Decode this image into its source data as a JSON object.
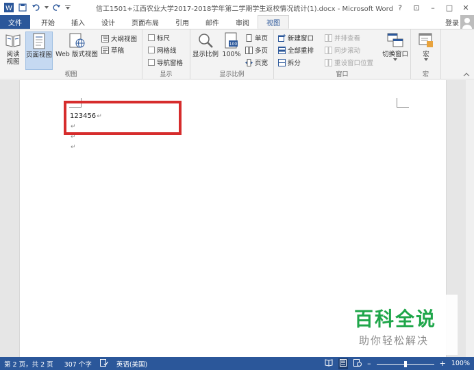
{
  "window": {
    "title": "信工1501+江西农业大学2017-2018学年第二学期学生返校情况统计(1).docx - Microsoft Word",
    "help": "?",
    "minimize": "–",
    "maximize": "□",
    "close": "✕",
    "ribbon_toggle": "⊡"
  },
  "tabs": [
    {
      "label": "文件"
    },
    {
      "label": "开始"
    },
    {
      "label": "插入"
    },
    {
      "label": "设计"
    },
    {
      "label": "页面布局"
    },
    {
      "label": "引用"
    },
    {
      "label": "邮件"
    },
    {
      "label": "审阅"
    },
    {
      "label": "视图"
    }
  ],
  "account": {
    "login": "登录"
  },
  "ribbon": {
    "views": {
      "label": "视图",
      "read_mode": "阅读\n视图",
      "print_layout": "页面视图",
      "web_layout": "Web 版式视图",
      "outline": "大纲视图",
      "draft": "草稿"
    },
    "show": {
      "label": "显示",
      "ruler": "标尺",
      "gridlines": "网格线",
      "nav_pane": "导航窗格"
    },
    "zoom": {
      "label": "显示比例",
      "zoom": "显示比例",
      "hundred": "100%",
      "one_page": "单页",
      "multi_page": "多页",
      "page_width": "页宽"
    },
    "window": {
      "label": "窗口",
      "new_window": "新建窗口",
      "arrange_all": "全部重排",
      "split": "拆分",
      "side_by_side": "并排查看",
      "sync_scroll": "同步滚动",
      "reset_pos": "重设窗口位置",
      "switch_windows": "切换窗口"
    },
    "macros": {
      "label": "宏",
      "macro": "宏"
    }
  },
  "document": {
    "line1": "123456",
    "pmark": "↵"
  },
  "watermark": {
    "title": "百科全说",
    "subtitle": "助你轻松解决"
  },
  "status": {
    "page": "第 2 页，共 2 页",
    "words": "307 个字",
    "lang": "英语(美国)",
    "zoom": "100%",
    "zoom_minus": "–",
    "zoom_plus": "+"
  },
  "colors": {
    "brand": "#2b579a",
    "highlight": "#d62c2c",
    "watermark_green": "#1fa64a"
  }
}
